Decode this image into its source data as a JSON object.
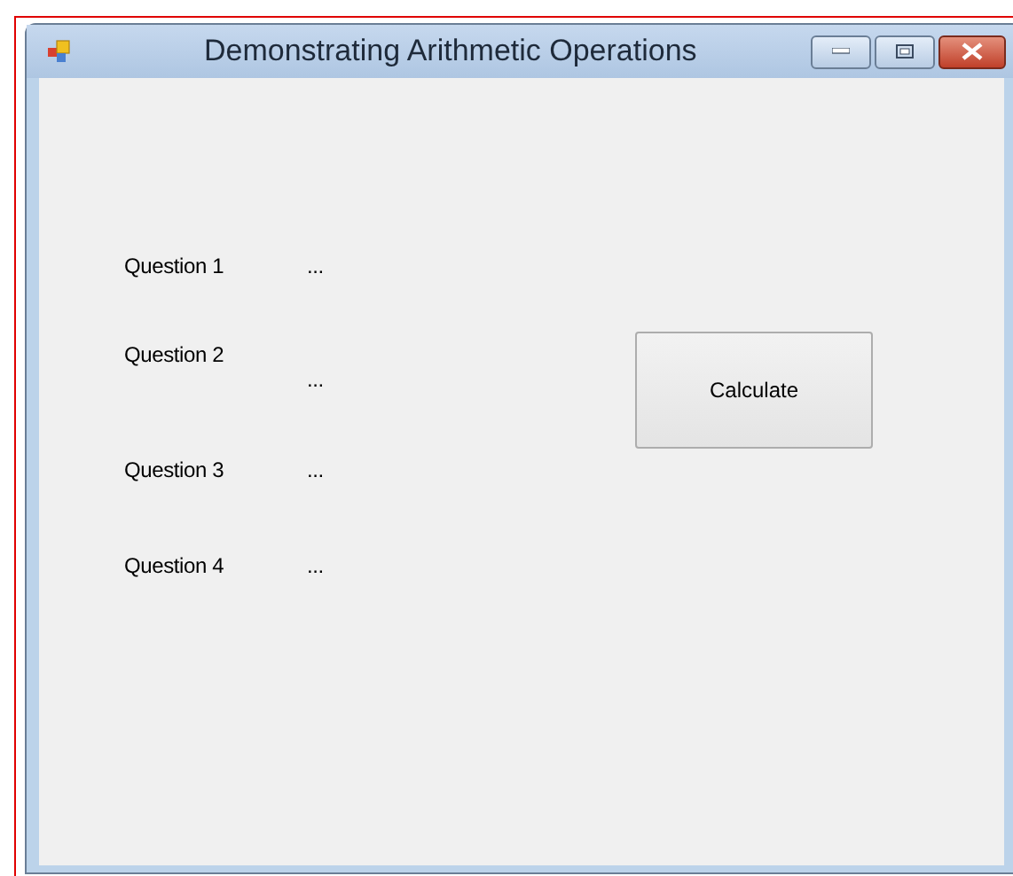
{
  "window": {
    "title": "Demonstrating Arithmetic Operations"
  },
  "questions": [
    {
      "label": "Question 1",
      "answer": "..."
    },
    {
      "label": "Question 2",
      "answer": "..."
    },
    {
      "label": "Question 3",
      "answer": "..."
    },
    {
      "label": "Question 4",
      "answer": "..."
    }
  ],
  "button": "Calculate"
}
